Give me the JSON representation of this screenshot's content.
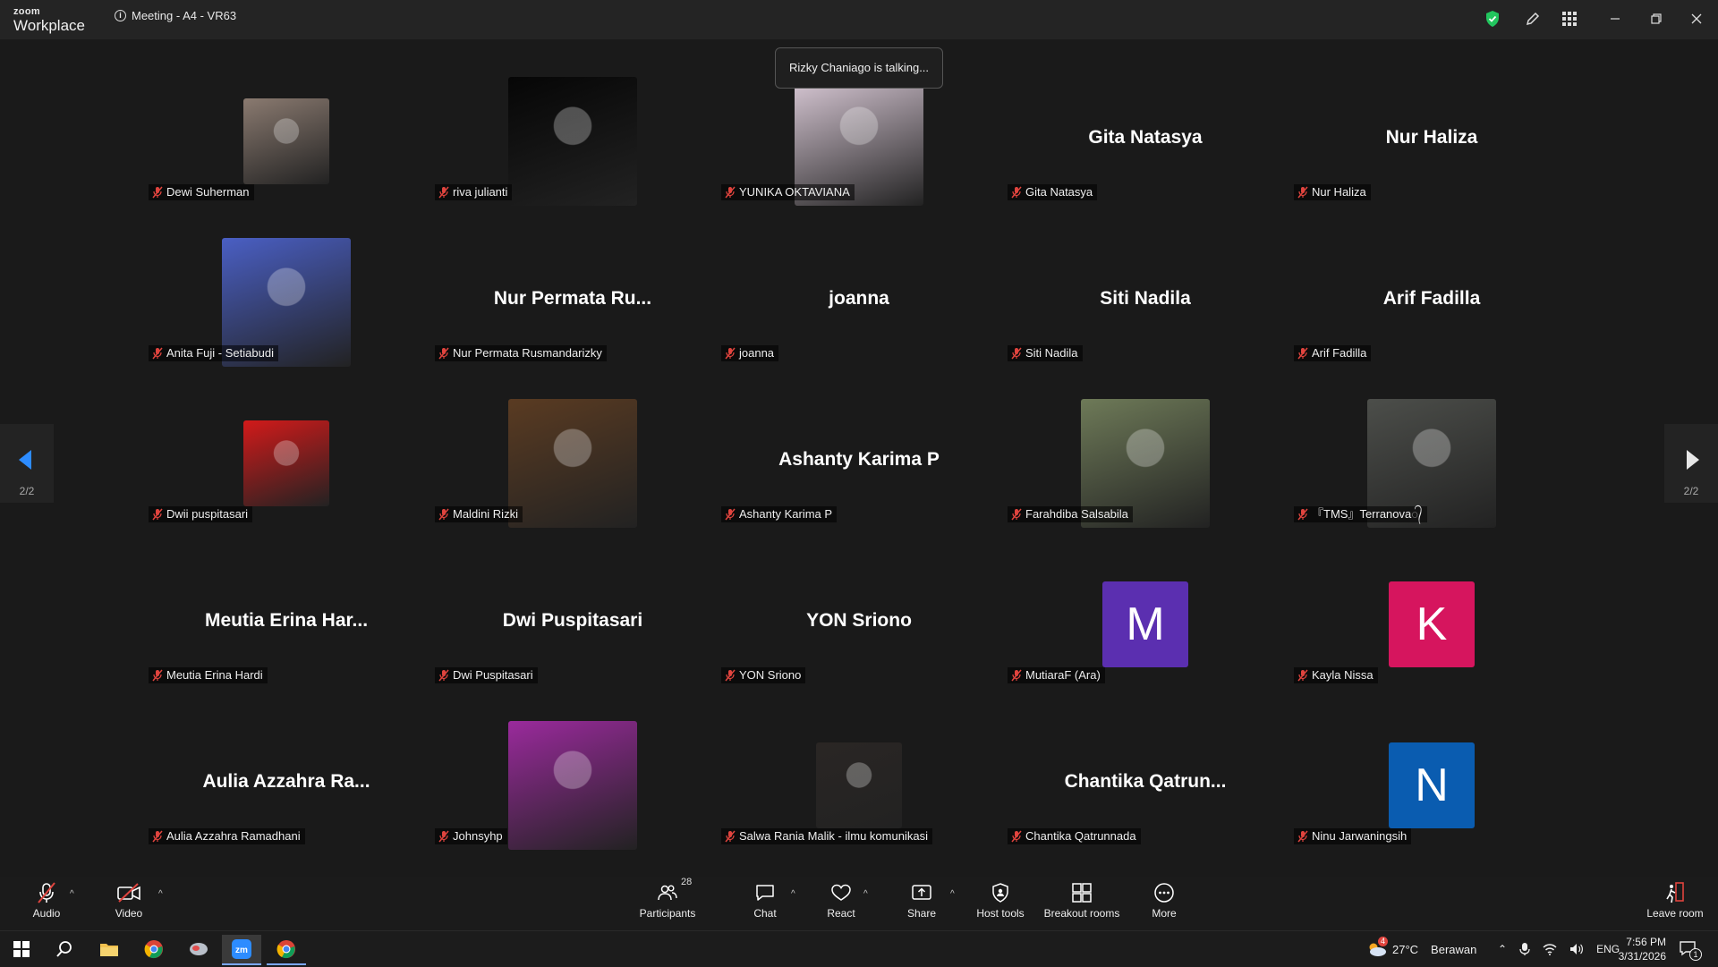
{
  "window": {
    "logo_top": "zoom",
    "logo_bottom": "Workplace",
    "meeting_title": "Meeting - A4 - VR63"
  },
  "toast": "Rizky Chaniago is talking...",
  "pager": {
    "left": "2/2",
    "right": "2/2"
  },
  "participants": [
    {
      "label": "Dewi Suherman",
      "display": "",
      "avatar": "photo-small",
      "color": "#8a7a70"
    },
    {
      "label": "riva julianti",
      "display": "",
      "avatar": "photo-big",
      "color": "#060606"
    },
    {
      "label": "YUNIKA OKTAVIANA",
      "display": "",
      "avatar": "photo-big",
      "color": "#d9c9d6"
    },
    {
      "label": "Gita Natasya",
      "display": "Gita Natasya",
      "avatar": "none",
      "color": ""
    },
    {
      "label": "Nur Haliza",
      "display": "Nur Haliza",
      "avatar": "none",
      "color": ""
    },
    {
      "label": "Anita Fuji - Setiabudi",
      "display": "",
      "avatar": "photo-big",
      "color": "#4a5fc4"
    },
    {
      "label": "Nur Permata Rusmandarizky",
      "display": "Nur Permata Ru...",
      "avatar": "none",
      "color": ""
    },
    {
      "label": "joanna",
      "display": "joanna",
      "avatar": "none",
      "color": ""
    },
    {
      "label": "Siti Nadila",
      "display": "Siti Nadila",
      "avatar": "none",
      "color": ""
    },
    {
      "label": "Arif Fadilla",
      "display": "Arif Fadilla",
      "avatar": "none",
      "color": ""
    },
    {
      "label": "Dwii puspitasari",
      "display": "",
      "avatar": "photo-small",
      "color": "#d21a1a"
    },
    {
      "label": "Maldini Rizki",
      "display": "",
      "avatar": "photo-big",
      "color": "#5a3b22"
    },
    {
      "label": "Ashanty Karima P",
      "display": "Ashanty Karima P",
      "avatar": "none",
      "color": ""
    },
    {
      "label": "Farahdiba Salsabila",
      "display": "",
      "avatar": "photo-big",
      "color": "#6e7a58"
    },
    {
      "label": "『TMS』Terranova᭄",
      "display": "",
      "avatar": "photo-big",
      "color": "#4c4e4a"
    },
    {
      "label": "Meutia Erina Hardi",
      "display": "Meutia Erina Har...",
      "avatar": "none",
      "color": ""
    },
    {
      "label": "Dwi Puspitasari",
      "display": "Dwi Puspitasari",
      "avatar": "none",
      "color": ""
    },
    {
      "label": "YON Sriono",
      "display": "YON Sriono",
      "avatar": "none",
      "color": ""
    },
    {
      "label": "MutiaraF (Ara)",
      "display": "",
      "avatar": "letter",
      "letter": "M",
      "color": "#5b2fb0"
    },
    {
      "label": "Kayla Nissa",
      "display": "",
      "avatar": "letter",
      "letter": "K",
      "color": "#d6155e"
    },
    {
      "label": "Aulia Azzahra Ramadhani",
      "display": "Aulia Azzahra Ra...",
      "avatar": "none",
      "color": ""
    },
    {
      "label": "Johnsyhp",
      "display": "",
      "avatar": "photo-big",
      "color": "#9a2a9c"
    },
    {
      "label": "Salwa Rania Malik - ilmu komunikasi",
      "display": "",
      "avatar": "photo-small",
      "color": "#2a2624"
    },
    {
      "label": "Chantika Qatrunnada",
      "display": "Chantika Qatrun...",
      "avatar": "none",
      "color": ""
    },
    {
      "label": "Ninu Jarwaningsih",
      "display": "",
      "avatar": "letter",
      "letter": "N",
      "color": "#0a5cb0"
    }
  ],
  "toolbar": {
    "audio": "Audio",
    "video": "Video",
    "participants": "Participants",
    "participants_count": "28",
    "chat": "Chat",
    "react": "React",
    "share": "Share",
    "host_tools": "Host tools",
    "breakout": "Breakout rooms",
    "more": "More",
    "leave": "Leave room"
  },
  "taskbar": {
    "weather_temp": "27°C",
    "weather_desc": "Berawan",
    "lang": "ENG",
    "time": "7:56 PM",
    "date": "3/31/2026",
    "notif_count": "1",
    "weather_badge": "4"
  },
  "colors": {
    "background": "#1a1a1a",
    "titlebar": "#242424",
    "shield": "#22c55e",
    "mute_red": "#e0443e",
    "arrow_blue": "#2d8cff"
  }
}
